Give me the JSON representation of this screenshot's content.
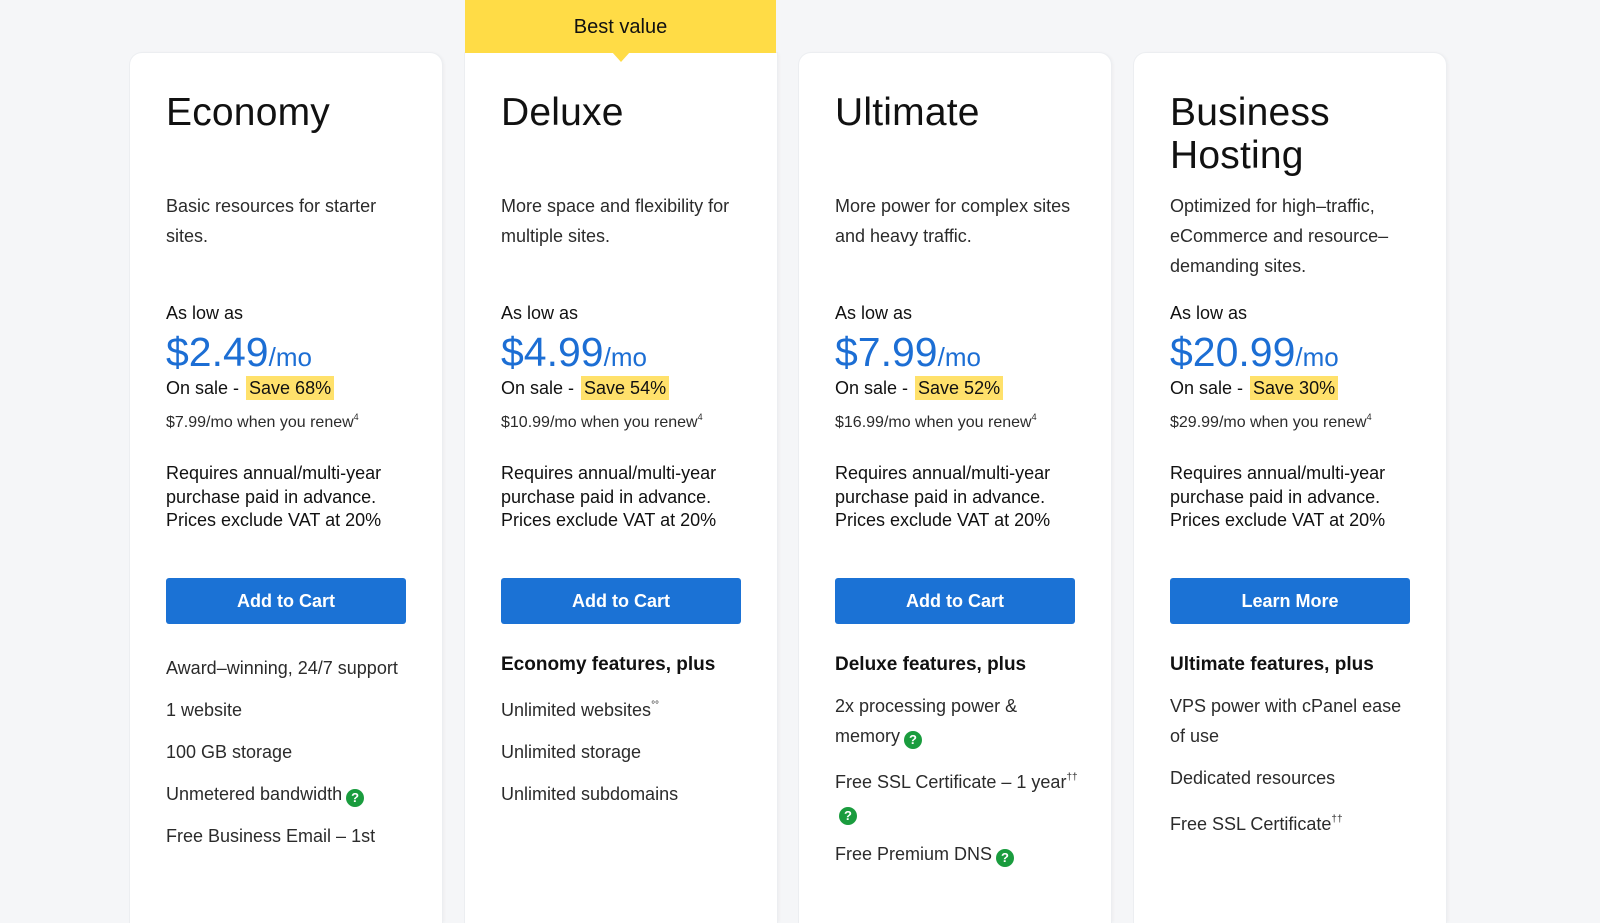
{
  "badge": {
    "label": "Best value",
    "color": "#ffdc46"
  },
  "colors": {
    "price": "#1c6ed4",
    "button": "#1b72d5",
    "highlight": "#ffe16b",
    "help_icon": "#1a9c3e"
  },
  "plans": [
    {
      "name": "Economy",
      "description": "Basic resources for starter sites.",
      "as_low_as": "As low as",
      "price": "$2.49",
      "per": "/mo",
      "sale_prefix": "On sale - ",
      "save": "Save 68%",
      "renew": "$7.99/mo when you renew",
      "renew_note": "4",
      "terms": "Requires annual/multi-year purchase paid in advance. Prices exclude VAT at 20%",
      "cta": "Add to Cart",
      "features_heading": "",
      "features": [
        {
          "text": "Award–winning, 24/7 support",
          "note": "",
          "help": false
        },
        {
          "text": "1 website",
          "note": "",
          "help": false
        },
        {
          "text": "100 GB storage",
          "note": "",
          "help": false
        },
        {
          "text": "Unmetered bandwidth",
          "note": "",
          "help": true
        },
        {
          "text": "Free Business Email – 1st",
          "note": "",
          "help": false
        }
      ]
    },
    {
      "name": "Deluxe",
      "description": "More space and flexibility for multiple sites.",
      "as_low_as": "As low as",
      "price": "$4.99",
      "per": "/mo",
      "sale_prefix": "On sale - ",
      "save": "Save 54%",
      "renew": "$10.99/mo when you renew",
      "renew_note": "4",
      "terms": "Requires annual/multi-year purchase paid in advance. Prices exclude VAT at 20%",
      "cta": "Add to Cart",
      "features_heading": "Economy features, plus",
      "features": [
        {
          "text": "Unlimited websites",
          "note": "°°",
          "help": false
        },
        {
          "text": "Unlimited storage",
          "note": "",
          "help": false
        },
        {
          "text": "Unlimited subdomains",
          "note": "",
          "help": false
        }
      ]
    },
    {
      "name": "Ultimate",
      "description": "More power for complex sites and heavy traffic.",
      "as_low_as": "As low as",
      "price": "$7.99",
      "per": "/mo",
      "sale_prefix": "On sale - ",
      "save": "Save 52%",
      "renew": "$16.99/mo when you renew",
      "renew_note": "4",
      "terms": "Requires annual/multi-year purchase paid in advance. Prices exclude VAT at 20%",
      "cta": "Add to Cart",
      "features_heading": "Deluxe features, plus",
      "features": [
        {
          "text": "2x processing power & memory",
          "note": "",
          "help": true
        },
        {
          "text": "Free SSL Certificate – 1 year",
          "note": "††",
          "help": true
        },
        {
          "text": "Free Premium DNS",
          "note": "",
          "help": true
        }
      ]
    },
    {
      "name": "Business Hosting",
      "description": "Optimized for high–traffic, eCommerce and resource–demanding sites.",
      "as_low_as": "As low as",
      "price": "$20.99",
      "per": "/mo",
      "sale_prefix": "On sale - ",
      "save": "Save 30%",
      "renew": "$29.99/mo when you renew",
      "renew_note": "4",
      "terms": "Requires annual/multi-year purchase paid in advance. Prices exclude VAT at 20%",
      "cta": "Learn More",
      "features_heading": "Ultimate features, plus",
      "features": [
        {
          "text": "VPS power with cPanel ease of use",
          "note": "",
          "help": false
        },
        {
          "text": "Dedicated resources",
          "note": "",
          "help": false
        },
        {
          "text": "Free SSL Certificate",
          "note": "††",
          "help": false
        }
      ]
    }
  ],
  "help_icon_glyph": "?"
}
